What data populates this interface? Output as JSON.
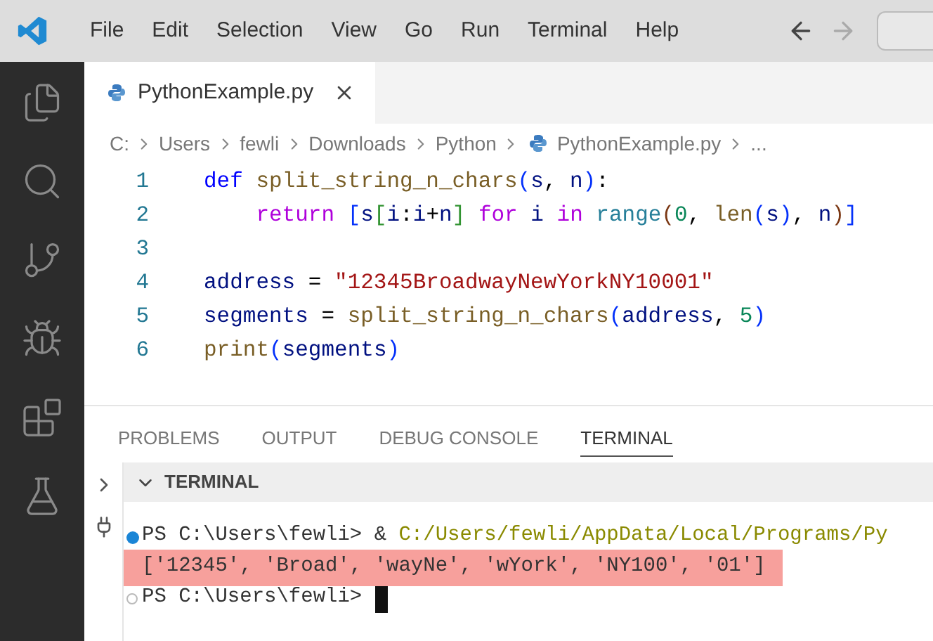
{
  "menu": [
    "File",
    "Edit",
    "Selection",
    "View",
    "Go",
    "Run",
    "Terminal",
    "Help"
  ],
  "editor_tabs": [
    {
      "label": "PythonExample.py",
      "selected": true
    }
  ],
  "breadcrumb": [
    {
      "text": "C:",
      "kind": "folder"
    },
    {
      "text": "Users",
      "kind": "folder"
    },
    {
      "text": "fewli",
      "kind": "folder"
    },
    {
      "text": "Downloads",
      "kind": "folder"
    },
    {
      "text": "Python",
      "kind": "folder"
    },
    {
      "text": "PythonExample.py",
      "kind": "file"
    },
    {
      "text": "...",
      "kind": "folder"
    }
  ],
  "code": [
    {
      "number": "1",
      "tokens": [
        {
          "text": "def ",
          "kind": "keyword"
        },
        {
          "text": "split_string_n_chars",
          "kind": "function"
        },
        {
          "text": "(",
          "kind": "bracket"
        },
        {
          "text": "s",
          "kind": "param"
        },
        {
          "text": ", ",
          "kind": "plain"
        },
        {
          "text": "n",
          "kind": "param"
        },
        {
          "text": ")",
          "kind": "bracket"
        },
        {
          "text": ":",
          "kind": "plain"
        }
      ]
    },
    {
      "number": "2",
      "tokens": [
        {
          "text": "    return ",
          "kind": "control"
        },
        {
          "text": "[",
          "kind": "bracket"
        },
        {
          "text": "s",
          "kind": "variable"
        },
        {
          "text": "[",
          "kind": "bracket2"
        },
        {
          "text": "i",
          "kind": "variable"
        },
        {
          "text": ":",
          "kind": "plain"
        },
        {
          "text": "i",
          "kind": "variable"
        },
        {
          "text": "+",
          "kind": "plain"
        },
        {
          "text": "n",
          "kind": "variable"
        },
        {
          "text": "]",
          "kind": "bracket2"
        },
        {
          "text": " for ",
          "kind": "control"
        },
        {
          "text": "i ",
          "kind": "variable"
        },
        {
          "text": "in ",
          "kind": "control"
        },
        {
          "text": "range",
          "kind": "builtin"
        },
        {
          "text": "(",
          "kind": "bracket3"
        },
        {
          "text": "0",
          "kind": "number"
        },
        {
          "text": ", ",
          "kind": "plain"
        },
        {
          "text": "len",
          "kind": "function"
        },
        {
          "text": "(",
          "kind": "bracket"
        },
        {
          "text": "s",
          "kind": "variable"
        },
        {
          "text": ")",
          "kind": "bracket"
        },
        {
          "text": ", ",
          "kind": "plain"
        },
        {
          "text": "n",
          "kind": "variable"
        },
        {
          "text": ")",
          "kind": "bracket3"
        },
        {
          "text": "]",
          "kind": "bracket"
        }
      ]
    },
    {
      "number": "3"
    },
    {
      "number": "4",
      "tokens": [
        {
          "text": "address",
          "kind": "variable"
        },
        {
          "text": " = ",
          "kind": "plain"
        },
        {
          "text": "\"12345BroadwayNewYorkNY10001\"",
          "kind": "string"
        }
      ]
    },
    {
      "number": "5",
      "tokens": [
        {
          "text": "segments",
          "kind": "variable"
        },
        {
          "text": " = ",
          "kind": "plain"
        },
        {
          "text": "split_string_n_chars",
          "kind": "function"
        },
        {
          "text": "(",
          "kind": "bracket"
        },
        {
          "text": "address",
          "kind": "variable"
        },
        {
          "text": ", ",
          "kind": "plain"
        },
        {
          "text": "5",
          "kind": "number"
        },
        {
          "text": ")",
          "kind": "bracket"
        }
      ]
    },
    {
      "number": "6",
      "tokens": [
        {
          "text": "print",
          "kind": "function"
        },
        {
          "text": "(",
          "kind": "bracket"
        },
        {
          "text": "segments",
          "kind": "variable"
        },
        {
          "text": ")",
          "kind": "bracket"
        }
      ]
    }
  ],
  "panel_tabs": [
    {
      "label": "PROBLEMS",
      "selected": false
    },
    {
      "label": "OUTPUT",
      "selected": false
    },
    {
      "label": "DEBUG CONSOLE",
      "selected": false
    },
    {
      "label": "TERMINAL",
      "selected": true
    }
  ],
  "terminal": {
    "title": "TERMINAL",
    "lines": [
      {
        "kind": "success",
        "highlighted": false,
        "cursor": false,
        "prompt": "PS C:\\Users\\fewli> & ",
        "command": "C:/Users/fewli/AppData/Local/Programs/Py"
      },
      {
        "kind": "output",
        "highlighted": true,
        "cursor": false,
        "prompt": "['12345', 'Broad', 'wayNe', 'wYork', 'NY100', '01']"
      },
      {
        "kind": "idle",
        "highlighted": false,
        "prompt": "PS C:\\Users\\fewli> ",
        "cursor": true
      }
    ]
  }
}
